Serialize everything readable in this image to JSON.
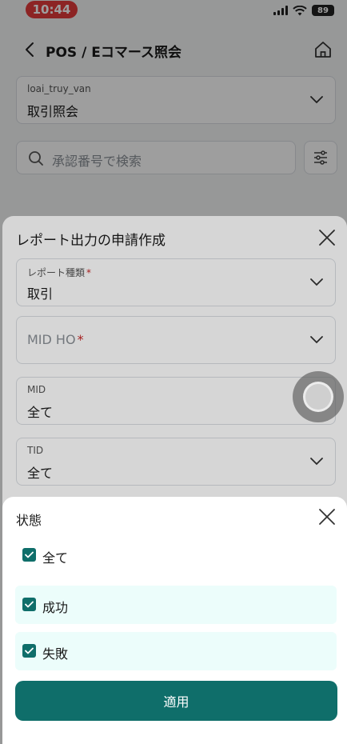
{
  "status_bar": {
    "time": "10:44",
    "battery": "89"
  },
  "header": {
    "title": "POS / Eコマース照会"
  },
  "query_type": {
    "label": "loai_truy_van",
    "value": "取引照会"
  },
  "search": {
    "placeholder": "承認番号で検索"
  },
  "report_sheet": {
    "title": "レポート出力の申請作成",
    "report_type": {
      "label": "レポート種類",
      "required_mark": "*",
      "value": "取引"
    },
    "mid_ho": {
      "placeholder": "MID HO",
      "required_mark": "*"
    },
    "mid": {
      "label": "MID",
      "value": "全て"
    },
    "tid": {
      "label": "TID",
      "value": "全て"
    }
  },
  "status_sheet": {
    "title": "状態",
    "options": [
      {
        "label": "全て",
        "checked": true
      },
      {
        "label": "成功",
        "checked": true
      },
      {
        "label": "失敗",
        "checked": true
      }
    ],
    "apply_label": "適用"
  },
  "colors": {
    "primary": "#0f6e6a",
    "selected_row": "#ecfdfb",
    "time_pill": "#e23b3b",
    "required": "#c62828"
  }
}
